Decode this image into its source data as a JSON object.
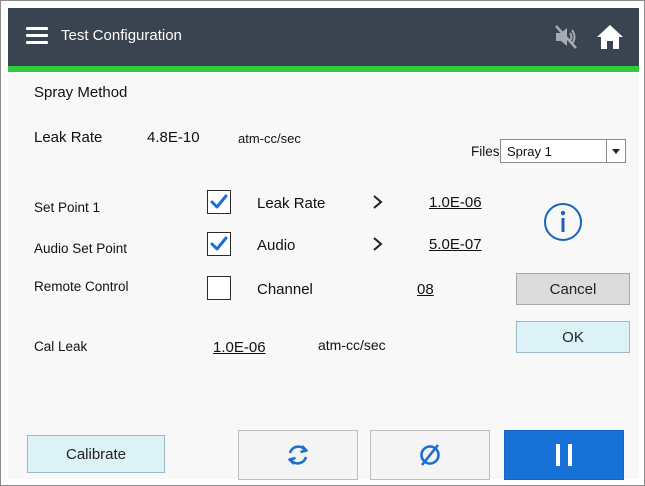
{
  "header": {
    "title": "Test Configuration",
    "icons": {
      "menu": "hamburger-menu-icon",
      "mute": "speaker-muted-icon",
      "home": "home-icon"
    }
  },
  "colors": {
    "header_bg": "#3a4350",
    "accent_green": "#2fcc3f",
    "primary_blue": "#1672d6",
    "check_blue": "#1a6fd1",
    "icon_blue": "#1565c0"
  },
  "section_title": "Spray Method",
  "leak_rate": {
    "label": "Leak Rate",
    "value": "4.8E-10",
    "unit": "atm-cc/sec"
  },
  "files": {
    "label": "Files",
    "selected": "Spray 1"
  },
  "rows": [
    {
      "label": "Set Point 1",
      "checked": true,
      "item": "Leak Rate",
      "value": "1.0E-06"
    },
    {
      "label": "Audio Set Point",
      "checked": true,
      "item": "Audio",
      "value": "5.0E-07"
    },
    {
      "label": "Remote Control",
      "checked": false,
      "item": "Channel",
      "value": "08"
    }
  ],
  "cal_leak": {
    "label": "Cal Leak",
    "value": "1.0E-06",
    "unit": "atm-cc/sec"
  },
  "buttons": {
    "cancel": "Cancel",
    "ok": "OK",
    "calibrate": "Calibrate",
    "refresh_icon": "refresh-icon",
    "null_icon": "empty-set-icon",
    "pause_icon": "pause-icon"
  }
}
